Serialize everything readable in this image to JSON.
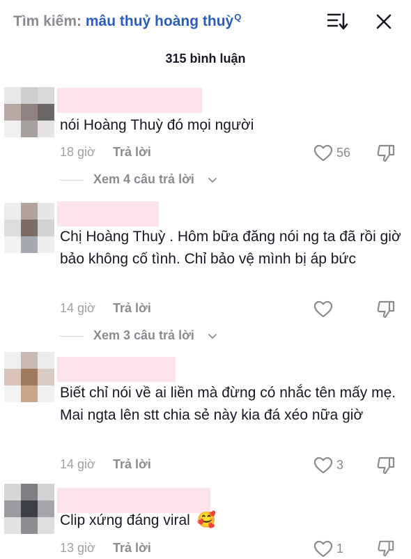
{
  "header": {
    "search_label": "Tìm kiếm: ",
    "search_term": "mâu thuỷ hoàng thuỳ",
    "search_sup": "Q"
  },
  "comment_count": "315 bình luận",
  "comments": [
    {
      "text": "nói Hoàng Thuỳ đó mọi người",
      "time": "18 giờ",
      "reply": "Trả lời",
      "likes": "56",
      "more_replies": "Xem 4 câu trả lời"
    },
    {
      "text": "Chị Hoàng Thuỳ . Hôm bữa đăng nói ng ta đã rồi giờ bảo không cố tình. Chỉ bảo vệ mình bị áp bức",
      "time": "14 giờ",
      "reply": "Trả lời",
      "likes": "",
      "more_replies": "Xem 3 câu trả lời"
    },
    {
      "text": "Biết chỉ nói về ai liền mà đừng có nhắc tên mấy mẹ. Mai ngta lên stt chia sẻ này kia đá xéo nữa giờ",
      "time": "14 giờ",
      "reply": "Trả lời",
      "likes": "3"
    },
    {
      "text": "Clip xứng đáng viral",
      "emoji": "🥰",
      "time": "13 giờ",
      "reply": "Trả lời",
      "likes": "1"
    }
  ],
  "icons": {
    "sort": "sort-icon",
    "close": "close-icon",
    "like": "heart-icon",
    "dislike": "thumbs-down-icon",
    "chevron": "chevron-down-icon"
  },
  "colors": {
    "search_term": "#2b5db9",
    "muted": "#8a8b91",
    "name_placeholder": "#fde4ea"
  }
}
